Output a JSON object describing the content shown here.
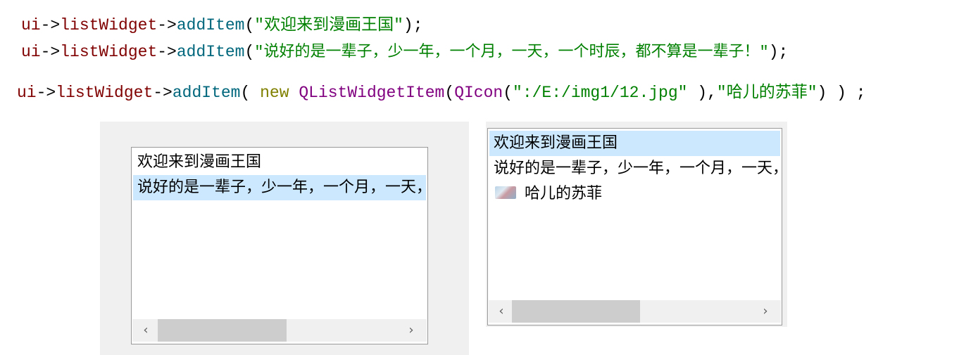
{
  "code": {
    "line1": {
      "obj": "ui",
      "arrow1": "->",
      "member": "listWidget",
      "arrow2": "->",
      "method": "addItem",
      "open": "(",
      "arg": "\"欢迎来到漫画王国\"",
      "close": ");"
    },
    "line2": {
      "obj": "ui",
      "arrow1": "->",
      "member": "listWidget",
      "arrow2": "->",
      "method": "addItem",
      "open": "(",
      "arg": "\"说好的是一辈子，少一年，一个月，一天，一个时辰，都不算是一辈子！\"",
      "close": ");"
    },
    "line3": {
      "obj": "ui",
      "arrow1": "->",
      "member": "listWidget",
      "arrow2": "->",
      "method": "addItem",
      "open": "( ",
      "kw_new": "new",
      "type_item": "QListWidgetItem",
      "paren1": "(",
      "type_icon": "QIcon",
      "paren2": "(",
      "path": "\":/E:/img1/12.jpg\"",
      "mid": " ),",
      "text": "\"哈儿的苏菲\"",
      "close": ") ) ;"
    }
  },
  "list_left": {
    "items": [
      {
        "label": "欢迎来到漫画王国",
        "selected": false
      },
      {
        "label": "说好的是一辈子，少一年，一个月，一天，一个时辰，都不算是一辈子！",
        "selected": true
      }
    ],
    "scroll_left_arrow": "‹",
    "scroll_right_arrow": "›"
  },
  "list_right": {
    "items": [
      {
        "label": "欢迎来到漫画王国",
        "selected": true,
        "icon": ""
      },
      {
        "label": "说好的是一辈子，少一年，一个月，一天，一个时辰，都不算是一辈子！",
        "selected": false,
        "icon": ""
      },
      {
        "label": "哈儿的苏菲",
        "selected": false,
        "icon": "image-thumbnail-icon"
      }
    ],
    "scroll_left_arrow": "‹",
    "scroll_right_arrow": "›"
  },
  "colors": {
    "selection": "#cce8ff",
    "panel_background": "#f0f0f0",
    "scroll_thumb": "#cdcdcd",
    "code_object": "#800000",
    "code_function": "#00677c",
    "code_string": "#008000",
    "code_keyword": "#808000",
    "code_type": "#800080"
  }
}
